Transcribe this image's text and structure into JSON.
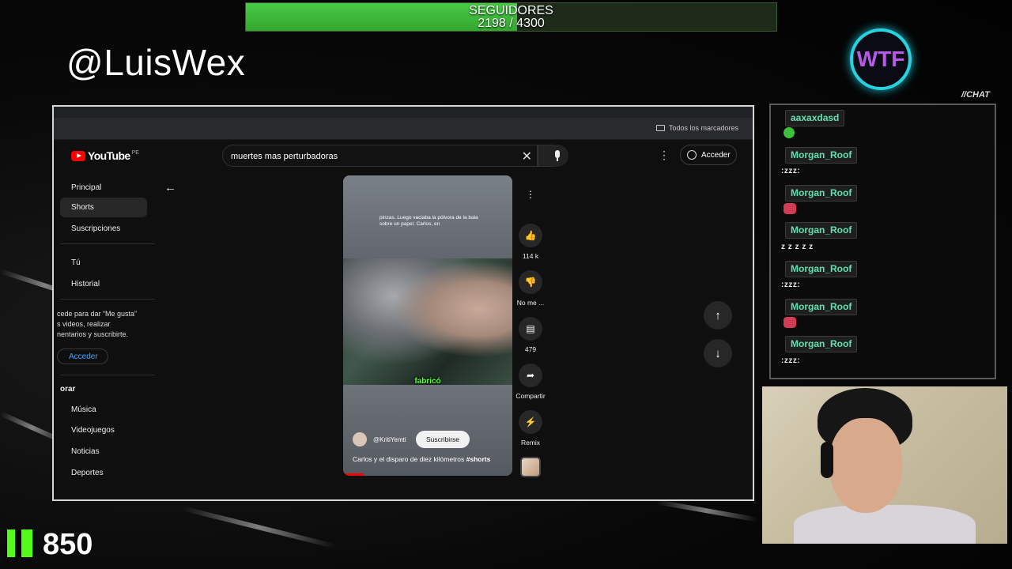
{
  "overlay": {
    "followers_label": "SEGUIDORES",
    "followers_current": "2198",
    "followers_sep": " / ",
    "followers_goal": "4300",
    "followers_progress": 0.511,
    "handle": "@LuisWex",
    "logo_text": "WTF",
    "chat_tag": "//CHAT",
    "kick_count": "850",
    "colors": {
      "progress_green": "#47c944",
      "kick_green": "#53fc18",
      "chat_name": "#5de2b0",
      "logo_ring": "#27d3de",
      "logo_text": "#b55ae8"
    }
  },
  "browser": {
    "bookmarks_label": "Todos los marcadores"
  },
  "youtube": {
    "logo": "YouTube",
    "country": "PE",
    "search_value": "muertes mas perturbadoras",
    "signin_label": "Acceder",
    "sidebar": {
      "items": [
        "Principal",
        "Shorts",
        "Suscripciones"
      ],
      "active": "Shorts",
      "you_items": [
        "Tú",
        "Historial"
      ],
      "signin_note": "cede para dar “Me gusta”\ns videos, realizar\nnentarios y suscribirte.",
      "signin_label": "Acceder",
      "explore_heading": "orar",
      "explore_items": [
        "Música",
        "Videojuegos",
        "Noticias",
        "Deportes"
      ]
    },
    "short": {
      "caption": "pinzas. Luego vaciaba la pólvora de la bala sobre un papel. Carlos, en",
      "subtitle_word": "fabricó",
      "channel": "@KritiYemti",
      "subscribe_label": "Suscribirse",
      "title": "Carlos y el disparo de diez kilómetros",
      "hashtag": "#shorts"
    },
    "actions": {
      "likes": "114 k",
      "dislike_label": "No me ...",
      "comments": "479",
      "share_label": "Compartir",
      "remix_label": "Remix"
    }
  },
  "chat": {
    "messages": [
      {
        "user": "aaxaxdasd",
        "text": "",
        "emote": "green-emote"
      },
      {
        "user": "Morgan_Roof",
        "text": ":zzz:",
        "emote": ""
      },
      {
        "user": "Morgan_Roof",
        "text": "",
        "emote": "red-emote"
      },
      {
        "user": "Morgan_Roof",
        "text": "z z z z z",
        "emote": ""
      },
      {
        "user": "Morgan_Roof",
        "text": ":zzz:",
        "emote": ""
      },
      {
        "user": "Morgan_Roof",
        "text": "",
        "emote": "red-emote"
      },
      {
        "user": "Morgan_Roof",
        "text": ":zzz:",
        "emote": ""
      }
    ]
  }
}
